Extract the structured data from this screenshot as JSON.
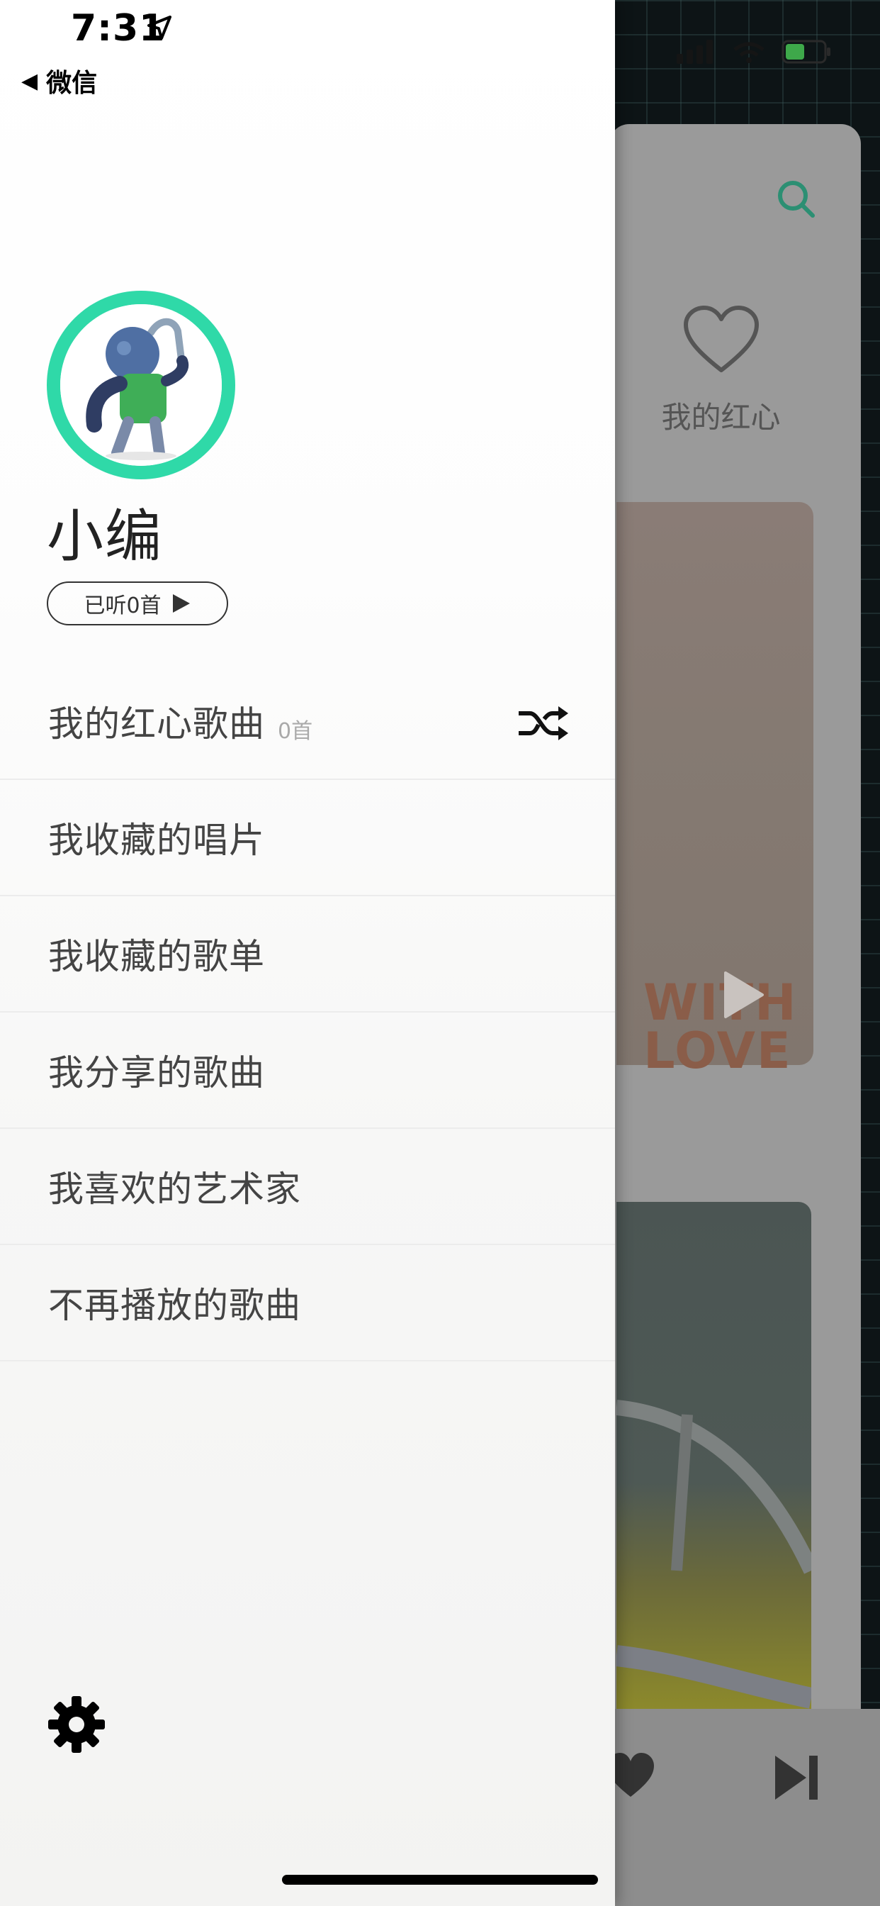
{
  "status_bar": {
    "time": "7:31"
  },
  "back_nav": {
    "arrow": "◀",
    "label": "微信"
  },
  "background": {
    "heart_label": "我的红心",
    "album_text": "WITH LOVE"
  },
  "profile": {
    "name": "小编",
    "listened_label": "已听0首"
  },
  "menu": {
    "items": [
      {
        "label": "我的红心歌曲",
        "count": "0首",
        "icon": "shuffle-icon"
      },
      {
        "label": "我收藏的唱片"
      },
      {
        "label": "我收藏的歌单"
      },
      {
        "label": "我分享的歌曲"
      },
      {
        "label": "我喜欢的艺术家"
      },
      {
        "label": "不再播放的歌曲"
      }
    ]
  },
  "colors": {
    "accent": "#2fd9a8",
    "text_primary": "#222222",
    "text_secondary": "#aaaaaa"
  },
  "icons": [
    "location-arrow-icon",
    "play-icon",
    "shuffle-icon",
    "gear-icon",
    "search-icon",
    "heart-icon",
    "next-track-icon"
  ]
}
